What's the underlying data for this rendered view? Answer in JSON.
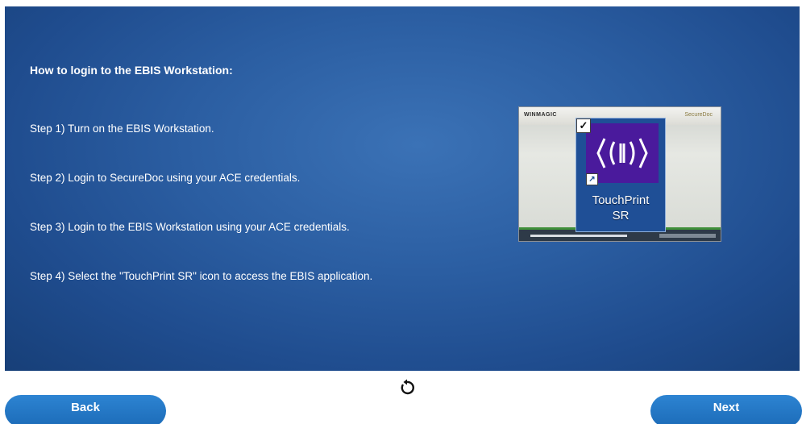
{
  "slide": {
    "title": "How to login to the EBIS Workstation:",
    "steps": [
      "Step 1) Turn on the EBIS Workstation.",
      "Step 2) Login to SecureDoc using your ACE credentials.",
      "Step 3) Login to the EBIS Workstation using your ACE credentials.",
      "Step 4) Select the \"TouchPrint SR\" icon to access the EBIS application."
    ]
  },
  "thumbnail": {
    "icon_label_line1": "TouchPrint",
    "icon_label_line2": "SR",
    "icon_name": "touchprint-sr-icon",
    "brand_left": "WINMAGIC",
    "brand_right": "SecureDoc"
  },
  "controls": {
    "back_label": "Back",
    "next_label": "Next",
    "replay_icon": "replay-icon"
  },
  "colors": {
    "slide_background": "#2b5ea2",
    "button_blue": "#1c6bb8",
    "icon_purple": "#4a1a9c",
    "text": "#ffffff"
  }
}
